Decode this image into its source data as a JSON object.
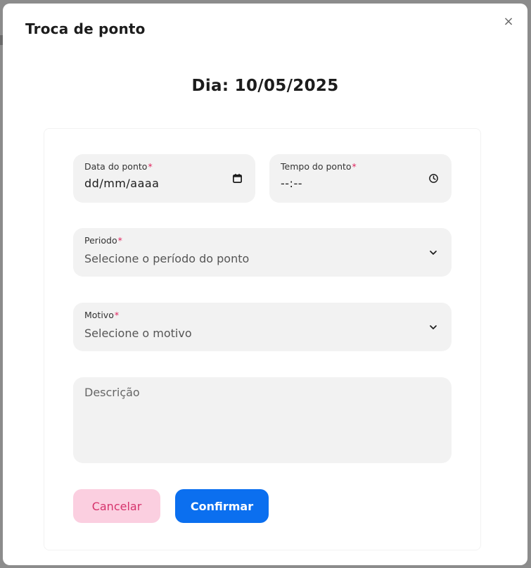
{
  "modal": {
    "title": "Troca de ponto",
    "close_icon": "×",
    "day_heading": "Dia: 10/05/2025"
  },
  "form": {
    "date": {
      "label": "Data do ponto",
      "required_mark": "*",
      "value": "dd/mm/aaaa",
      "icon": "calendar-icon"
    },
    "time": {
      "label": "Tempo do ponto",
      "required_mark": "*",
      "value": "--:--",
      "icon": "clock-icon"
    },
    "period": {
      "label": "Periodo",
      "required_mark": "*",
      "placeholder": "Selecione o período do ponto",
      "icon": "chevron-down-icon"
    },
    "reason": {
      "label": "Motivo",
      "required_mark": "*",
      "placeholder": "Selecione o motivo",
      "icon": "chevron-down-icon"
    },
    "description": {
      "placeholder": "Descrição"
    }
  },
  "actions": {
    "cancel_label": "Cancelar",
    "confirm_label": "Confirmar"
  },
  "colors": {
    "accent": "#0b6fef",
    "cancel_bg": "#fbcfe0",
    "cancel_text": "#d6336c",
    "required": "#e0245e",
    "field_bg": "#f2f2f2"
  }
}
